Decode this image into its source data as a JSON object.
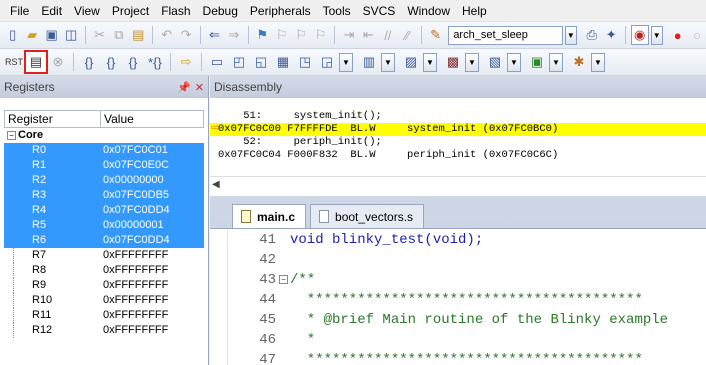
{
  "menu": [
    "File",
    "Edit",
    "View",
    "Project",
    "Flash",
    "Debug",
    "Peripherals",
    "Tools",
    "SVCS",
    "Window",
    "Help"
  ],
  "toolbar": {
    "target_combo": "arch_set_sleep"
  },
  "registers_pane": {
    "title": "Registers",
    "col_register": "Register",
    "col_value": "Value",
    "group": "Core",
    "rows": [
      {
        "name": "R0",
        "value": "0x07FC0C01",
        "selected": true
      },
      {
        "name": "R1",
        "value": "0x07FC0E0C",
        "selected": true
      },
      {
        "name": "R2",
        "value": "0x00000000",
        "selected": true
      },
      {
        "name": "R3",
        "value": "0x07FC0DB5",
        "selected": true
      },
      {
        "name": "R4",
        "value": "0x07FC0DD4",
        "selected": true
      },
      {
        "name": "R5",
        "value": "0x00000001",
        "selected": true
      },
      {
        "name": "R6",
        "value": "0x07FC0DD4",
        "selected": true
      },
      {
        "name": "R7",
        "value": "0xFFFFFFFF",
        "selected": false
      },
      {
        "name": "R8",
        "value": "0xFFFFFFFF",
        "selected": false
      },
      {
        "name": "R9",
        "value": "0xFFFFFFFF",
        "selected": false
      },
      {
        "name": "R10",
        "value": "0xFFFFFFFF",
        "selected": false
      },
      {
        "name": "R11",
        "value": "0xFFFFFFFF",
        "selected": false
      },
      {
        "name": "R12",
        "value": "0xFFFFFFFF",
        "selected": false
      }
    ]
  },
  "disassembly": {
    "title": "Disassembly",
    "lines": [
      {
        "text": "    51:     system_init();",
        "current": false
      },
      {
        "text": "0x07FC0C00 F7FFFFDE  BL.W     system_init (0x07FC0BC0)",
        "current": true
      },
      {
        "text": "    52:     periph_init();",
        "current": false
      },
      {
        "text": "0x07FC0C04 F000F832  BL.W     periph_init (0x07FC0C6C)",
        "current": false
      }
    ]
  },
  "editor": {
    "tabs": [
      {
        "label": "main.c",
        "active": true
      },
      {
        "label": "boot_vectors.s",
        "active": false
      }
    ],
    "lines": [
      {
        "num": "41",
        "text": "void blinky_test(void);",
        "kind": "code"
      },
      {
        "num": "42",
        "text": "",
        "kind": "code"
      },
      {
        "num": "43",
        "text": "/**",
        "kind": "comment",
        "fold": true
      },
      {
        "num": "44",
        "text": "  ****************************************",
        "kind": "comment"
      },
      {
        "num": "45",
        "text": "  * @brief Main routine of the Blinky example",
        "kind": "comment"
      },
      {
        "num": "46",
        "text": "  *",
        "kind": "comment"
      },
      {
        "num": "47",
        "text": "  ****************************************",
        "kind": "comment"
      }
    ]
  }
}
